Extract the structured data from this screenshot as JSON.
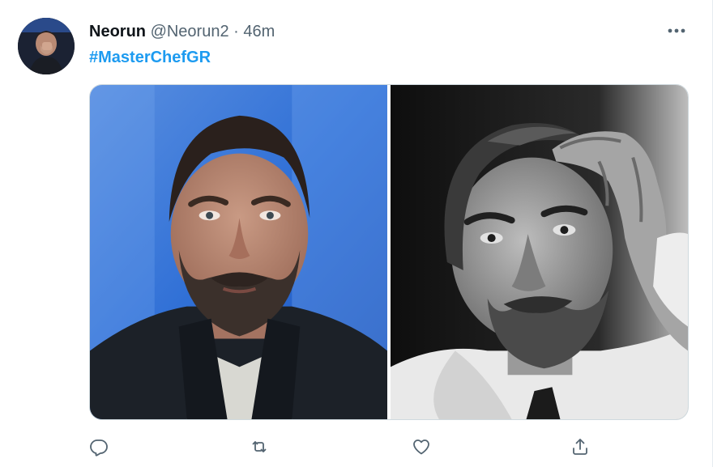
{
  "tweet": {
    "display_name": "Neorun",
    "handle": "@Neorun2",
    "separator": "·",
    "time": "46m",
    "hashtag": "#MasterChefGR"
  },
  "icons": {
    "more": "more-horizontal-icon",
    "reply": "reply-icon",
    "retweet": "retweet-icon",
    "like": "heart-icon",
    "share": "share-icon"
  },
  "media": {
    "photos": [
      {
        "description_tag": "left-photo-bearded-man-blue-stage"
      },
      {
        "description_tag": "right-photo-bw-bearded-man-hand-on-head"
      }
    ]
  },
  "colors": {
    "accent": "#1d9bf0",
    "secondary_text": "#536471",
    "icon_gray": "#536471"
  }
}
